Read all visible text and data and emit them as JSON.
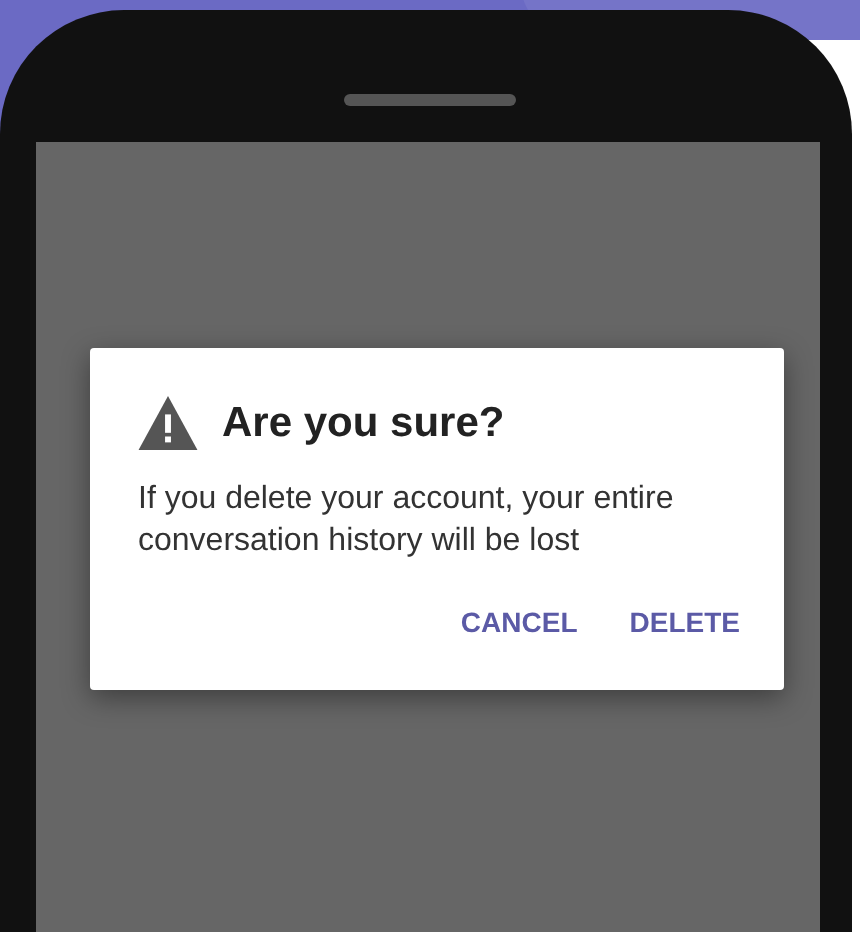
{
  "dialog": {
    "title": "Are you sure?",
    "message": "If you delete your account, your entire conversation history will be lost",
    "buttons": [
      {
        "label": "CANCEL"
      },
      {
        "label": "DELETE"
      }
    ]
  }
}
